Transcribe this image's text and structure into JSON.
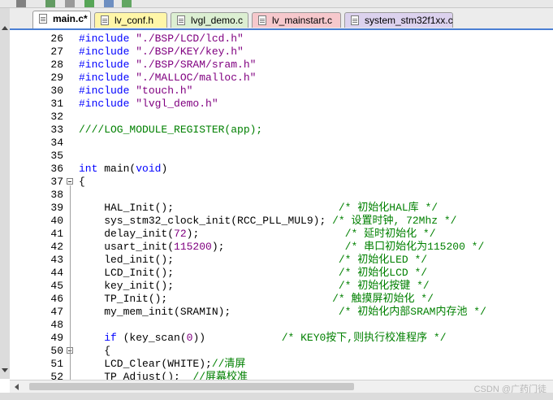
{
  "toolbar": {
    "icons": [
      "tools-icon",
      "layout-icon",
      "window-icon",
      "diamond-icon",
      "filter-icon",
      "check-window-icon"
    ]
  },
  "tabs": [
    {
      "label": "main.c*",
      "active": true,
      "color": "#ffffff"
    },
    {
      "label": "lv_conf.h",
      "active": false,
      "color": "#fff6a8"
    },
    {
      "label": "lvgl_demo.c",
      "active": false,
      "color": "#dcefd2"
    },
    {
      "label": "lv_mainstart.c",
      "active": false,
      "color": "#f6c8cc"
    },
    {
      "label": "system_stm32f1xx.c",
      "active": false,
      "color": "#dcd2ee"
    }
  ],
  "lines": [
    {
      "n": "26",
      "code": [
        {
          "t": "#include ",
          "c": "kw"
        },
        {
          "t": "\"./BSP/LCD/lcd.h\"",
          "c": "str"
        }
      ]
    },
    {
      "n": "27",
      "code": [
        {
          "t": "#include ",
          "c": "kw"
        },
        {
          "t": "\"./BSP/KEY/key.h\"",
          "c": "str"
        }
      ]
    },
    {
      "n": "28",
      "code": [
        {
          "t": "#include ",
          "c": "kw"
        },
        {
          "t": "\"./BSP/SRAM/sram.h\"",
          "c": "str"
        }
      ]
    },
    {
      "n": "29",
      "code": [
        {
          "t": "#include ",
          "c": "kw"
        },
        {
          "t": "\"./MALLOC/malloc.h\"",
          "c": "str"
        }
      ]
    },
    {
      "n": "30",
      "code": [
        {
          "t": "#include ",
          "c": "kw"
        },
        {
          "t": "\"touch.h\"",
          "c": "str"
        }
      ]
    },
    {
      "n": "31",
      "code": [
        {
          "t": "#include ",
          "c": "kw"
        },
        {
          "t": "\"lvgl_demo.h\"",
          "c": "str"
        }
      ]
    },
    {
      "n": "32",
      "code": []
    },
    {
      "n": "33",
      "code": [
        {
          "t": "////LOG_MODULE_REGISTER(app);",
          "c": "cmt"
        }
      ]
    },
    {
      "n": "34",
      "code": []
    },
    {
      "n": "35",
      "code": []
    },
    {
      "n": "36",
      "code": [
        {
          "t": "int ",
          "c": "kw"
        },
        {
          "t": "main(",
          "c": ""
        },
        {
          "t": "void",
          "c": "kw"
        },
        {
          "t": ")",
          "c": ""
        }
      ]
    },
    {
      "n": "37",
      "fold": true,
      "code": [
        {
          "t": "{",
          "c": ""
        }
      ]
    },
    {
      "n": "38",
      "code": []
    },
    {
      "n": "39",
      "code": [
        {
          "t": "    HAL_Init();                          ",
          "c": ""
        },
        {
          "t": "/* 初始化HAL库 */",
          "c": "cmt"
        }
      ]
    },
    {
      "n": "40",
      "code": [
        {
          "t": "    sys_stm32_clock_init(RCC_PLL_MUL9); ",
          "c": ""
        },
        {
          "t": "/* 设置时钟, 72Mhz */",
          "c": "cmt"
        }
      ]
    },
    {
      "n": "41",
      "code": [
        {
          "t": "    delay_init(",
          "c": ""
        },
        {
          "t": "72",
          "c": "num"
        },
        {
          "t": ");                       ",
          "c": ""
        },
        {
          "t": "/* 延时初始化 */",
          "c": "cmt"
        }
      ]
    },
    {
      "n": "42",
      "code": [
        {
          "t": "    usart_init(",
          "c": ""
        },
        {
          "t": "115200",
          "c": "num"
        },
        {
          "t": ");                   ",
          "c": ""
        },
        {
          "t": "/* 串口初始化为115200 */",
          "c": "cmt"
        }
      ]
    },
    {
      "n": "43",
      "code": [
        {
          "t": "    led_init();                          ",
          "c": ""
        },
        {
          "t": "/* 初始化LED */",
          "c": "cmt"
        }
      ]
    },
    {
      "n": "44",
      "code": [
        {
          "t": "    LCD_Init();                          ",
          "c": ""
        },
        {
          "t": "/* 初始化LCD */",
          "c": "cmt"
        }
      ]
    },
    {
      "n": "45",
      "code": [
        {
          "t": "    key_init();                          ",
          "c": ""
        },
        {
          "t": "/* 初始化按键 */",
          "c": "cmt"
        }
      ]
    },
    {
      "n": "46",
      "code": [
        {
          "t": "    TP_Init();                          ",
          "c": ""
        },
        {
          "t": "/* 触摸屏初始化 */",
          "c": "cmt"
        }
      ]
    },
    {
      "n": "47",
      "code": [
        {
          "t": "    my_mem_init(SRAMIN);                 ",
          "c": ""
        },
        {
          "t": "/* 初始化内部SRAM内存池 */",
          "c": "cmt"
        }
      ]
    },
    {
      "n": "48",
      "code": []
    },
    {
      "n": "49",
      "code": [
        {
          "t": "    ",
          "c": ""
        },
        {
          "t": "if",
          "c": "kw"
        },
        {
          "t": " (key_scan(",
          "c": ""
        },
        {
          "t": "0",
          "c": "num"
        },
        {
          "t": "))            ",
          "c": ""
        },
        {
          "t": "/* KEY0按下,则执行校准程序 */",
          "c": "cmt"
        }
      ]
    },
    {
      "n": "50",
      "fold": true,
      "code": [
        {
          "t": "    {",
          "c": ""
        }
      ]
    },
    {
      "n": "51",
      "code": [
        {
          "t": "    LCD_Clear(WHITE);",
          "c": ""
        },
        {
          "t": "//清屏",
          "c": "cmt"
        }
      ]
    },
    {
      "n": "52",
      "code": [
        {
          "t": "    TP_Adjust();  ",
          "c": ""
        },
        {
          "t": "//屏幕校准",
          "c": "cmt"
        }
      ]
    }
  ],
  "watermark": "CSDN @广药门徒"
}
